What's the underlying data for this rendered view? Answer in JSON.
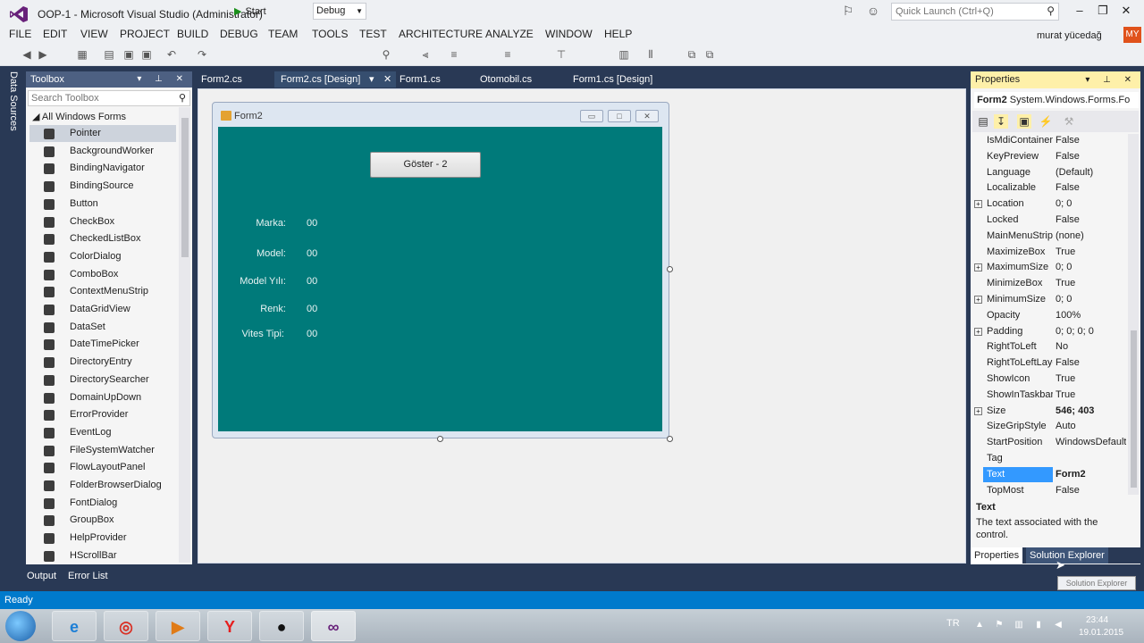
{
  "app": {
    "title": "OOP-1 - Microsoft Visual Studio (Administrator)",
    "quick_launch_placeholder": "Quick Launch (Ctrl+Q)",
    "user_name": "murat yücedağ",
    "user_initials": "MY"
  },
  "menu": [
    "FILE",
    "EDIT",
    "VIEW",
    "PROJECT",
    "BUILD",
    "DEBUG",
    "TEAM",
    "TOOLS",
    "TEST",
    "ARCHITECTURE",
    "ANALYZE",
    "WINDOW",
    "HELP"
  ],
  "toolbar": {
    "start_label": "Start",
    "configuration": "Debug"
  },
  "side_strip": {
    "label": "Data Sources"
  },
  "toolbox": {
    "title": "Toolbox",
    "search_placeholder": "Search Toolbox",
    "group": "All Windows Forms",
    "items": [
      "Pointer",
      "BackgroundWorker",
      "BindingNavigator",
      "BindingSource",
      "Button",
      "CheckBox",
      "CheckedListBox",
      "ColorDialog",
      "ComboBox",
      "ContextMenuStrip",
      "DataGridView",
      "DataSet",
      "DateTimePicker",
      "DirectoryEntry",
      "DirectorySearcher",
      "DomainUpDown",
      "ErrorProvider",
      "EventLog",
      "FileSystemWatcher",
      "FlowLayoutPanel",
      "FolderBrowserDialog",
      "FontDialog",
      "GroupBox",
      "HelpProvider",
      "HScrollBar"
    ],
    "selected_index": 0
  },
  "doc_tabs": [
    {
      "label": "Form2.cs",
      "active": false
    },
    {
      "label": "Form2.cs [Design]",
      "active": true
    },
    {
      "label": "Form1.cs",
      "active": false
    },
    {
      "label": "Otomobil.cs",
      "active": false
    },
    {
      "label": "Form1.cs [Design]",
      "active": false
    }
  ],
  "form": {
    "title": "Form2",
    "button_label": "Göster - 2",
    "back_color": "#007a7a",
    "fields": [
      {
        "label": "Marka:",
        "value": "00"
      },
      {
        "label": "Model:",
        "value": "00"
      },
      {
        "label": "Model Yılı:",
        "value": "00"
      },
      {
        "label": "Renk:",
        "value": "00"
      },
      {
        "label": "Vites Tipi:",
        "value": "00"
      }
    ]
  },
  "properties": {
    "title": "Properties",
    "object_name": "Form2",
    "object_type": "System.Windows.Forms.Fo",
    "rows": [
      {
        "name": "IsMdiContainer",
        "value": "False"
      },
      {
        "name": "KeyPreview",
        "value": "False"
      },
      {
        "name": "Language",
        "value": "(Default)"
      },
      {
        "name": "Localizable",
        "value": "False"
      },
      {
        "name": "Location",
        "value": "0; 0",
        "expandable": true
      },
      {
        "name": "Locked",
        "value": "False"
      },
      {
        "name": "MainMenuStrip",
        "value": "(none)"
      },
      {
        "name": "MaximizeBox",
        "value": "True"
      },
      {
        "name": "MaximumSize",
        "value": "0; 0",
        "expandable": true
      },
      {
        "name": "MinimizeBox",
        "value": "True"
      },
      {
        "name": "MinimumSize",
        "value": "0; 0",
        "expandable": true
      },
      {
        "name": "Opacity",
        "value": "100%"
      },
      {
        "name": "Padding",
        "value": "0; 0; 0; 0",
        "expandable": true
      },
      {
        "name": "RightToLeft",
        "value": "No"
      },
      {
        "name": "RightToLeftLayout",
        "value": "False"
      },
      {
        "name": "ShowIcon",
        "value": "True"
      },
      {
        "name": "ShowInTaskbar",
        "value": "True"
      },
      {
        "name": "Size",
        "value": "546; 403",
        "expandable": true,
        "bold": true
      },
      {
        "name": "SizeGripStyle",
        "value": "Auto"
      },
      {
        "name": "StartPosition",
        "value": "WindowsDefault"
      },
      {
        "name": "Tag",
        "value": ""
      },
      {
        "name": "Text",
        "value": "Form2",
        "selected": true,
        "bold": true
      },
      {
        "name": "TopMost",
        "value": "False"
      }
    ],
    "description_title": "Text",
    "description_text": "The text associated with the control.",
    "bottom_tabs": [
      "Properties",
      "Solution Explorer"
    ],
    "tooltip": "Solution Explorer"
  },
  "output_tabs": [
    "Output",
    "Error List"
  ],
  "status": "Ready",
  "taskbar": {
    "language": "TR",
    "time": "23:44",
    "date": "19.01.2015",
    "apps": [
      {
        "name": "internet-explorer",
        "glyph": "e"
      },
      {
        "name": "chrome",
        "glyph": "◎"
      },
      {
        "name": "media-player",
        "glyph": "▶"
      },
      {
        "name": "yandex",
        "glyph": "Y"
      },
      {
        "name": "obs",
        "glyph": "●"
      },
      {
        "name": "visual-studio",
        "glyph": "∞"
      }
    ]
  },
  "colors": {
    "accent": "#007acc",
    "chrome_dark": "#293955",
    "form_back": "#007a7a",
    "selection": "#3399ff"
  }
}
